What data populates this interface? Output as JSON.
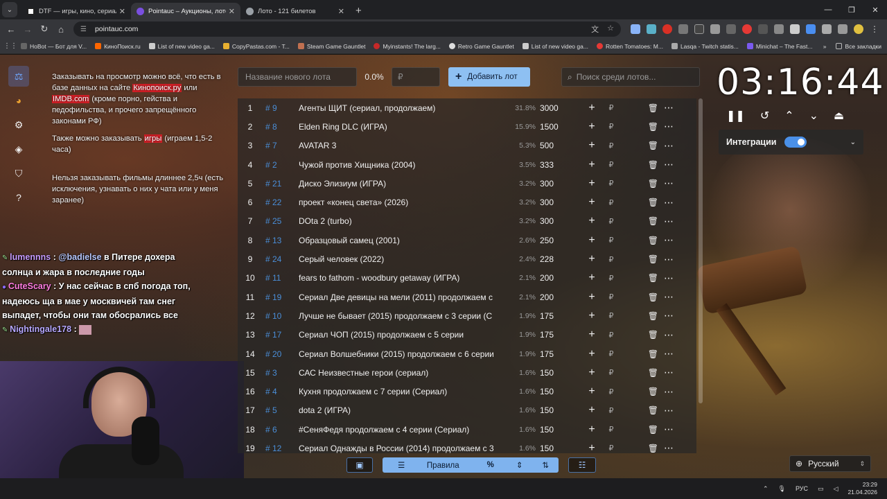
{
  "browser": {
    "tabs": [
      {
        "title": "DTF — игры, кино, сериалы, р",
        "active": false,
        "fav_color": "#ffffff"
      },
      {
        "title": "Pointauc – Аукционы, лотереи",
        "active": true,
        "fav_color": "#7a4fe0"
      },
      {
        "title": "Лото - 121 билетов",
        "active": false,
        "fav_color": "#9aa0a6"
      }
    ],
    "url": "pointauc.com",
    "bookmarks": [
      "HoBot — Бот для V...",
      "КиноПоиск.ru",
      "List of new video ga...",
      "CopyPastas.com - T...",
      "Steam Game Gauntlet",
      "Myinstants! The larg...",
      "Retro Game Gauntlet",
      "List of new video ga...",
      "Rotten Tomatoes: M...",
      "Lasqa - Twitch statis...",
      "Minichat – The Fast..."
    ],
    "bookmarks_all": "Все закладки"
  },
  "rules": {
    "p1_a": "Заказывать на просмотр можно всё, что есть в базе данных на сайте ",
    "p1_link1": "Кинопоиск.ру",
    "p1_b": " или ",
    "p1_link2": "IMDB.com",
    "p1_c": " (кроме порно, гейства и педофильства, и прочего запрещённого законами РФ)",
    "p2_a": "Также можно заказывать ",
    "p2_link": "игры",
    "p2_b": " (играем 1,5-2 часа)",
    "p3": "Нельзя заказывать фильмы длиннее 2,5ч (есть исключения, узнавать о них у чата или у меня заранее)"
  },
  "chat": [
    {
      "user": "lumennns",
      "mention": "@badielse",
      "text": " в Питере дохера солнца и жара в последние годы"
    },
    {
      "user": "CuteScary",
      "mention": "",
      "text": "У нас сейчас в спб погода топ, надеюсь ща в мае у москвичей там снег выпадет, чтобы они там обосрались все"
    },
    {
      "user": "Nightingale178",
      "mention": "",
      "text": ""
    }
  ],
  "lot_input": {
    "name_placeholder": "Название нового лота",
    "percent": "0.0%",
    "amount_placeholder": "₽",
    "add_label": "Добавить лот",
    "search_placeholder": "Поиск среди лотов..."
  },
  "lots": [
    {
      "n": "1",
      "id": "# 9",
      "name": "Агенты ЩИТ (сериал, продолжаем)",
      "pct": "31.8%",
      "amount": "3000"
    },
    {
      "n": "2",
      "id": "# 8",
      "name": "Elden Ring DLC (ИГРА)",
      "pct": "15.9%",
      "amount": "1500"
    },
    {
      "n": "3",
      "id": "# 7",
      "name": "AVATAR 3",
      "pct": "5.3%",
      "amount": "500"
    },
    {
      "n": "4",
      "id": "# 2",
      "name": "Чужой против Хищника (2004)",
      "pct": "3.5%",
      "amount": "333"
    },
    {
      "n": "5",
      "id": "# 21",
      "name": "Диско Элизиум (ИГРА)",
      "pct": "3.2%",
      "amount": "300"
    },
    {
      "n": "6",
      "id": "# 22",
      "name": "проект «конец света» (2026)",
      "pct": "3.2%",
      "amount": "300"
    },
    {
      "n": "7",
      "id": "# 25",
      "name": "DOta 2 (turbo)",
      "pct": "3.2%",
      "amount": "300"
    },
    {
      "n": "8",
      "id": "# 13",
      "name": "Образцовый самец (2001)",
      "pct": "2.6%",
      "amount": "250"
    },
    {
      "n": "9",
      "id": "# 24",
      "name": "Серый человек (2022)",
      "pct": "2.4%",
      "amount": "228"
    },
    {
      "n": "10",
      "id": "# 11",
      "name": "fears to fathom - woodbury getaway (ИГРА)",
      "pct": "2.1%",
      "amount": "200"
    },
    {
      "n": "11",
      "id": "# 19",
      "name": "Сериал Две девицы на мели (2011) продолжаем с",
      "pct": "2.1%",
      "amount": "200"
    },
    {
      "n": "12",
      "id": "# 10",
      "name": "Лучше не бывает (2015) продолжаем с 3 серии (С",
      "pct": "1.9%",
      "amount": "175"
    },
    {
      "n": "13",
      "id": "# 17",
      "name": "Сериал ЧОП (2015) продолжаем с 5 серии",
      "pct": "1.9%",
      "amount": "175"
    },
    {
      "n": "14",
      "id": "# 20",
      "name": "Сериал Волшебники (2015) продолжаем с 6 серии",
      "pct": "1.9%",
      "amount": "175"
    },
    {
      "n": "15",
      "id": "# 3",
      "name": "САС Неизвестные герои (сериал)",
      "pct": "1.6%",
      "amount": "150"
    },
    {
      "n": "16",
      "id": "# 4",
      "name": "Кухня продолжаем с 7 серии (Сериал)",
      "pct": "1.6%",
      "amount": "150"
    },
    {
      "n": "17",
      "id": "# 5",
      "name": "dota 2 (ИГРА)",
      "pct": "1.6%",
      "amount": "150"
    },
    {
      "n": "18",
      "id": "# 6",
      "name": " #СеняФедя продолжаем с 4 серии (Сериал)",
      "pct": "1.6%",
      "amount": "150"
    },
    {
      "n": "19",
      "id": "# 12",
      "name": "Сериал Однажды в России (2014) продолжаем с 3",
      "pct": "1.6%",
      "amount": "150"
    }
  ],
  "lot_actions": {
    "plus": "+",
    "ruble": "₽",
    "delete": "🗑",
    "more": "⋯"
  },
  "bottom_bar": {
    "rules_label": "Правила",
    "percent": "%"
  },
  "timer": {
    "value": "03:16:44"
  },
  "integrations": {
    "label": "Интеграции",
    "enabled": true
  },
  "language": {
    "value": "Русский"
  },
  "taskbar": {
    "lang": "РУС",
    "time": "23:29",
    "date": "21.04.2026"
  }
}
